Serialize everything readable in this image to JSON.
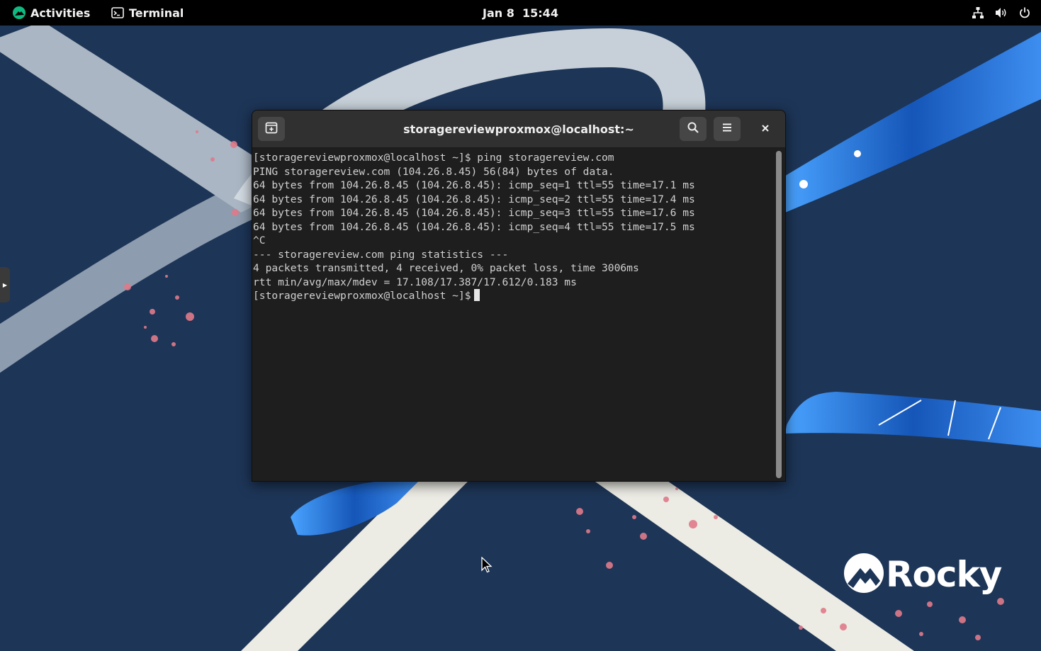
{
  "topbar": {
    "activities_label": "Activities",
    "app_label": "Terminal",
    "clock_date": "Jan 8",
    "clock_time": "15:44",
    "tray_icons": [
      "network-icon",
      "volume-icon",
      "power-icon"
    ]
  },
  "terminal": {
    "title": "storagereviewproxmox@localhost:~",
    "header_buttons": [
      "new-tab-icon",
      "search-icon",
      "menu-icon",
      "close-icon"
    ],
    "lines": [
      "[storagereviewproxmox@localhost ~]$ ping storagereview.com",
      "PING storagereview.com (104.26.8.45) 56(84) bytes of data.",
      "64 bytes from 104.26.8.45 (104.26.8.45): icmp_seq=1 ttl=55 time=17.1 ms",
      "64 bytes from 104.26.8.45 (104.26.8.45): icmp_seq=2 ttl=55 time=17.4 ms",
      "64 bytes from 104.26.8.45 (104.26.8.45): icmp_seq=3 ttl=55 time=17.6 ms",
      "64 bytes from 104.26.8.45 (104.26.8.45): icmp_seq=4 ttl=55 time=17.5 ms",
      "^C",
      "--- storagereview.com ping statistics ---",
      "4 packets transmitted, 4 received, 0% packet loss, time 3006ms",
      "rtt min/avg/max/mdev = 17.108/17.387/17.612/0.183 ms"
    ],
    "prompt": "[storagereviewproxmox@localhost ~]$"
  },
  "wallpaper": {
    "logo_text": "Rocky",
    "colors": {
      "background": "#1d3557",
      "ribbon_white": "#ece9e0",
      "ribbon_blue": "#1f64c8",
      "accent_pink": "#e07a8a",
      "activities_green": "#10b981"
    }
  }
}
